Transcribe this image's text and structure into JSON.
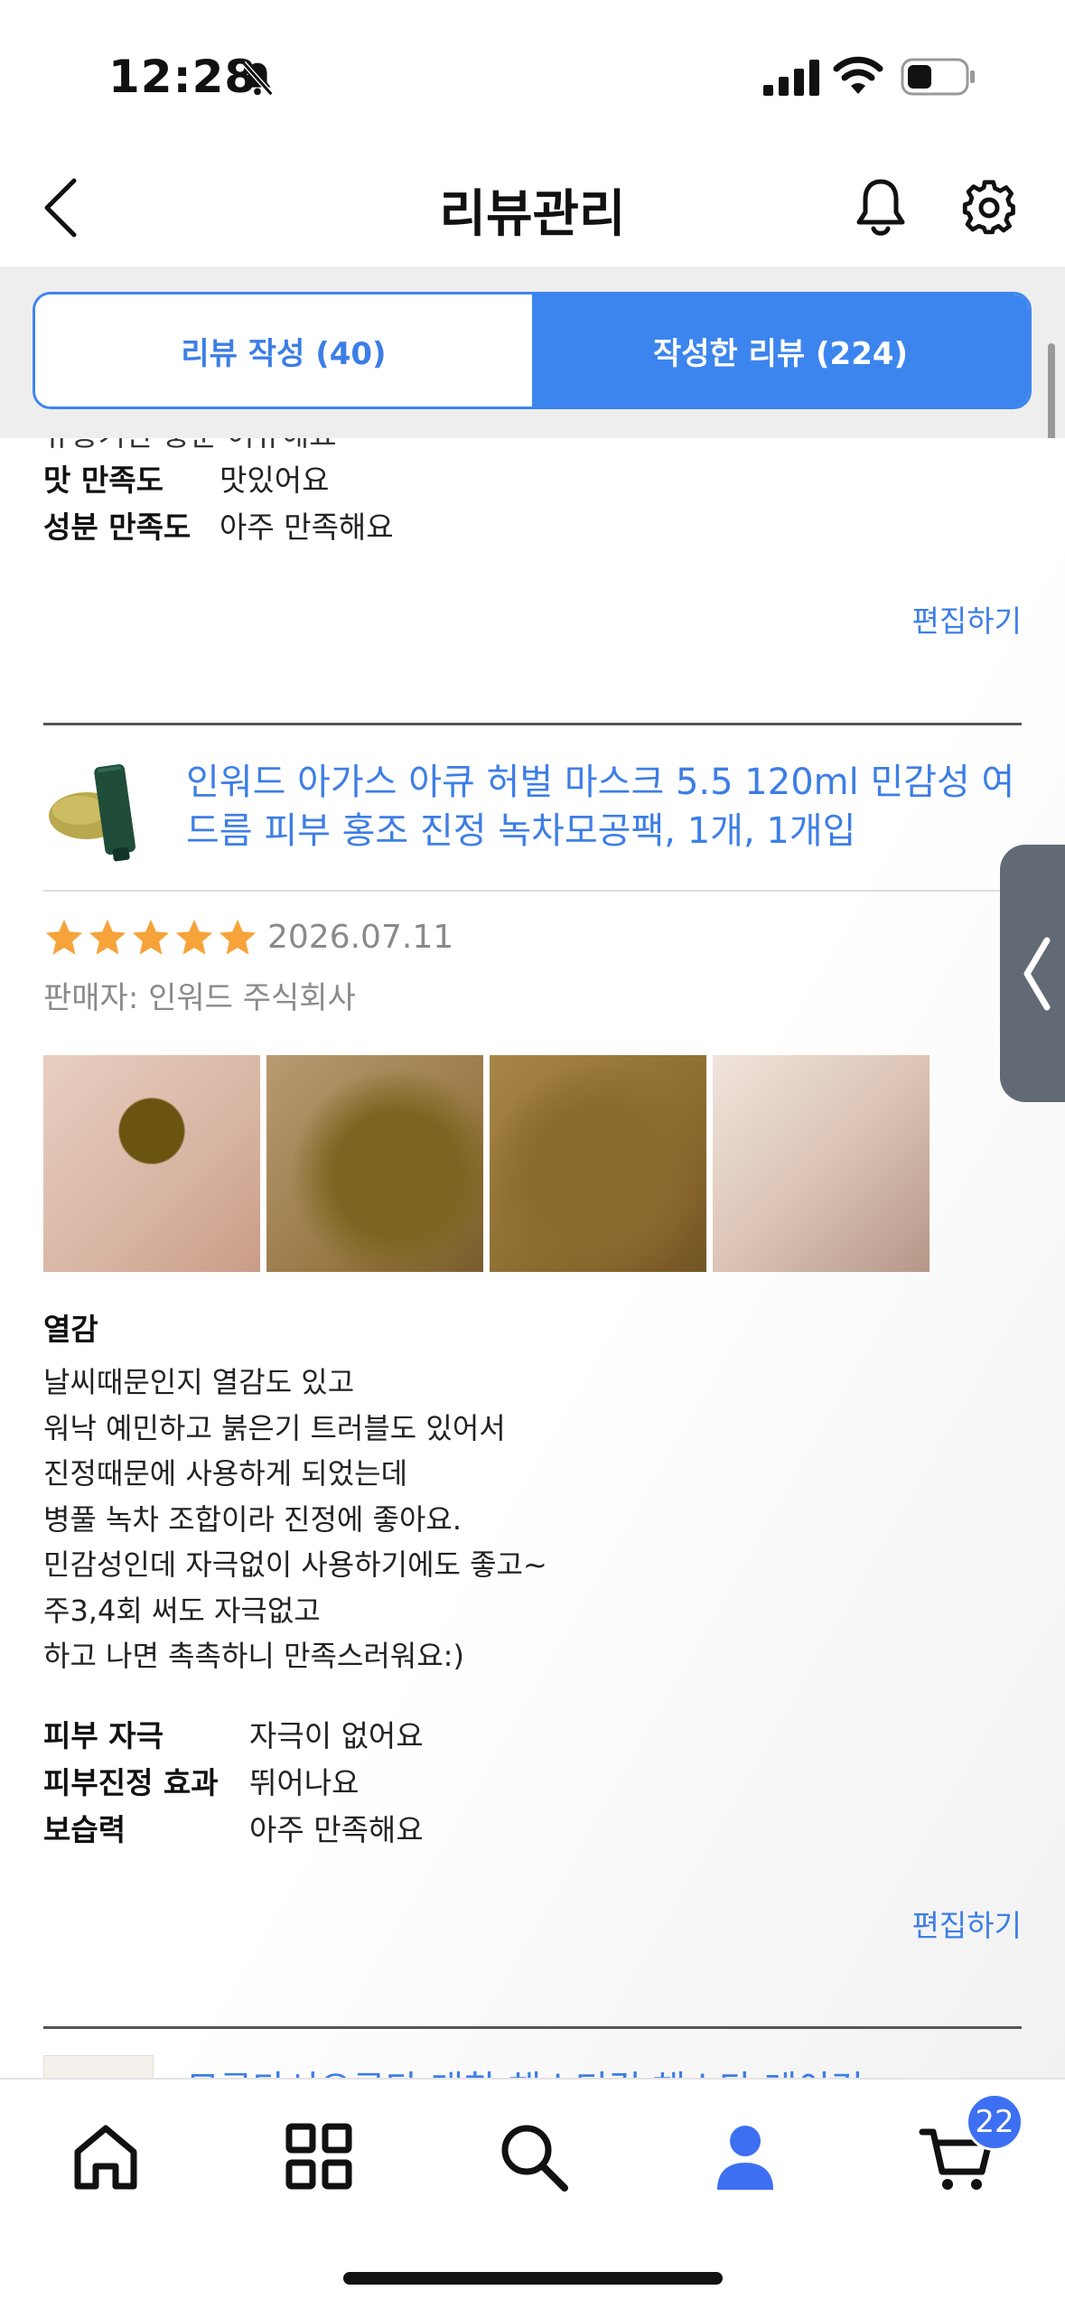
{
  "status_bar": {
    "time": "12:28"
  },
  "header": {
    "title": "리뷰관리"
  },
  "tabs": [
    {
      "label": "리뷰 작성 (40)"
    },
    {
      "label": "작성한 리뷰 (224)"
    }
  ],
  "prev_review": {
    "clipped_text": "유통기한   충분 여유해요",
    "attributes": [
      {
        "key": "맛 만족도",
        "value": "맛있어요"
      },
      {
        "key": "성분 만족도",
        "value": "아주 만족해요"
      }
    ],
    "edit_label": "편집하기"
  },
  "review": {
    "product_name": "인워드 아가스 아큐 허벌 마스크 5.5 120ml 민감성 여드름 피부 홍조 진정 녹차모공팩, 1개, 1개입",
    "rating": 5,
    "date": "2026.07.11",
    "seller": "판매자: 인워드 주식회사",
    "title": "열감",
    "body_lines": [
      "날씨때문인지 열감도 있고",
      "워낙 예민하고 붉은기 트러블도 있어서",
      "진정때문에 사용하게 되었는데",
      "병풀 녹차 조합이라 진정에 좋아요.",
      "민감성인데 자극없이 사용하기에도 좋고~",
      "주3,4회 써도 자극없고",
      "하고 나면 촉촉하니 만족스러워요:)"
    ],
    "attributes": [
      {
        "key": "피부 자극",
        "value": "자극이 없어요"
      },
      {
        "key": "피부진정 효과",
        "value": "뛰어나요"
      },
      {
        "key": "보습력",
        "value": "아주 만족해요"
      }
    ],
    "edit_label": "편집하기"
  },
  "next_review": {
    "product_name_partial": "모공다시오공타 대창 해스티컴 해스타 레이건 ..."
  },
  "bottom_nav": {
    "items": [
      "home-icon",
      "grid-icon",
      "search-icon",
      "profile-icon",
      "cart-icon"
    ],
    "cart_count": "22"
  },
  "colors": {
    "accent": "#3d85ee",
    "star": "#f6a33a",
    "link": "#3d7ee6"
  }
}
